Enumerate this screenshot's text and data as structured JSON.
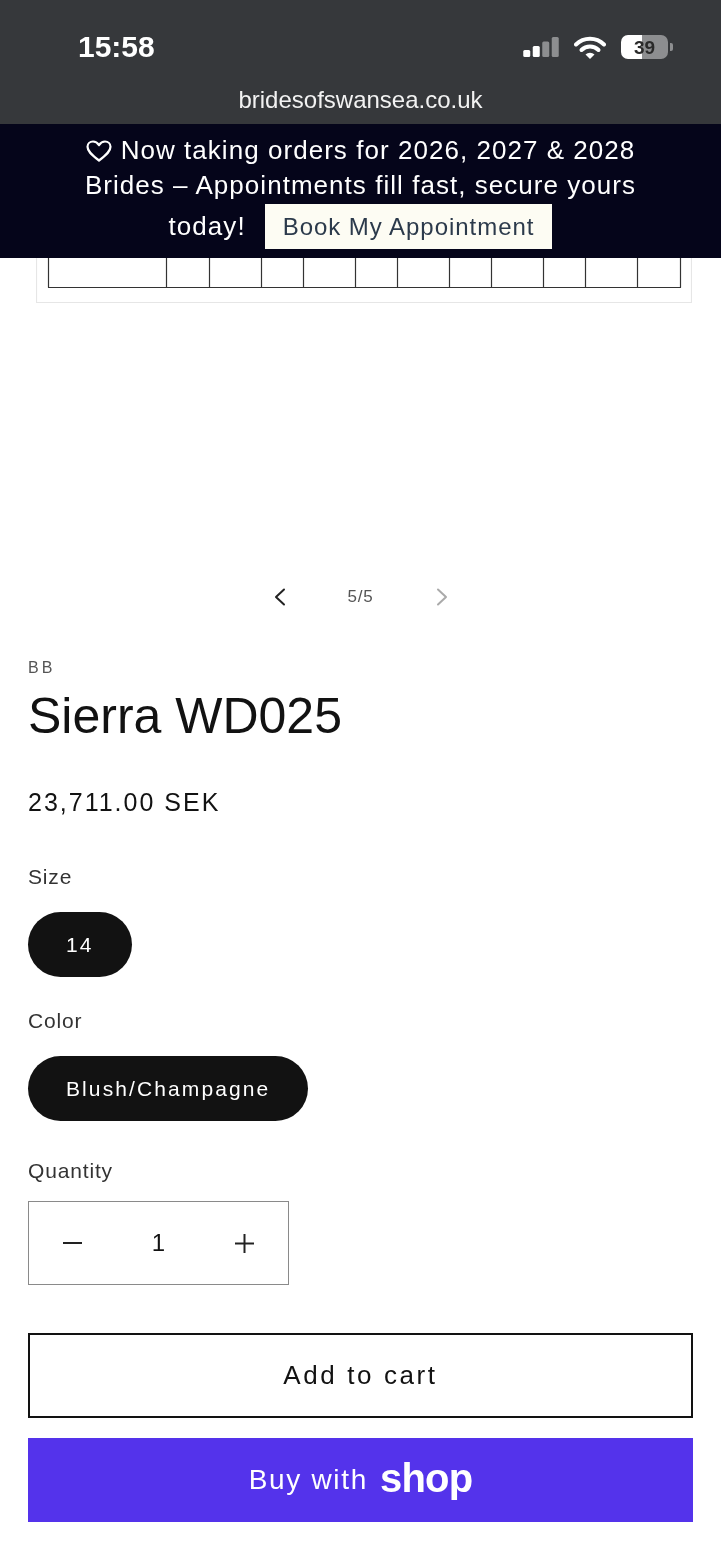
{
  "status_bar": {
    "time": "15:58",
    "battery": "39"
  },
  "address_bar": {
    "url": "bridesofswansea.co.uk"
  },
  "announcement": {
    "lines": [
      "Now taking orders for 2026, 2027 & 2028",
      "Brides – Appointments fill fast, secure yours",
      "today!"
    ],
    "button": "Book My Appointment"
  },
  "gallery": {
    "counter": "5/5",
    "previous_disabled": false,
    "next_disabled": true
  },
  "product": {
    "vendor": "BB",
    "title": "Sierra WD025",
    "price": "23,711.00 SEK"
  },
  "options": [
    {
      "label": "Size",
      "values": [
        {
          "label": "14",
          "selected": true
        }
      ]
    },
    {
      "label": "Color",
      "values": [
        {
          "label": "Blush/Champagne",
          "selected": true
        }
      ]
    }
  ],
  "quantity": {
    "label": "Quantity",
    "value": "1"
  },
  "actions": {
    "add_to_cart": "Add to cart",
    "buy_now": "Buy with",
    "buy_now_brand": "shop"
  }
}
